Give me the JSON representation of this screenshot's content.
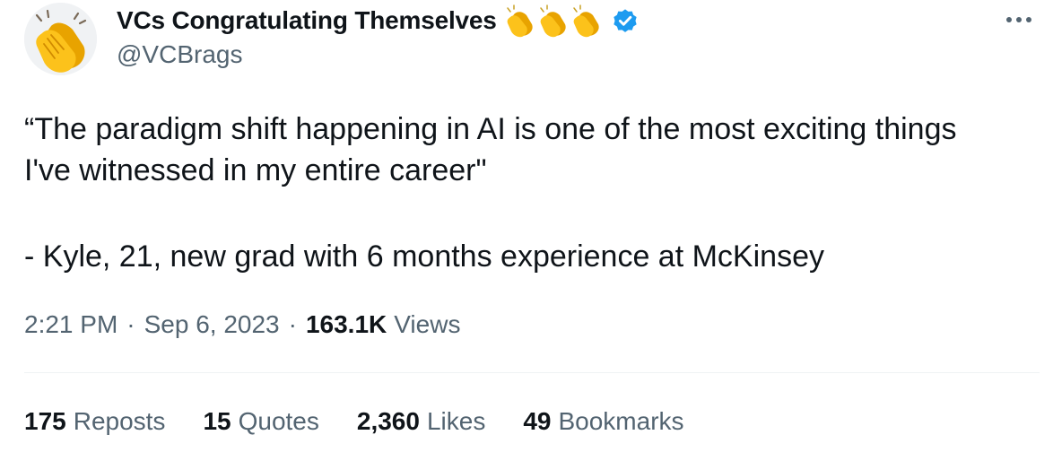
{
  "author": {
    "display_name": "VCs Congratulating Themselves",
    "handle": "@VCBrags",
    "avatar_icon": "clapping-hands-emoji",
    "name_emojis": [
      "clapping-hands-emoji",
      "clapping-hands-emoji",
      "clapping-hands-emoji"
    ],
    "verified": true,
    "verified_color": "#1d9bf0"
  },
  "tweet": {
    "lines": [
      "“The paradigm shift happening in AI is one of the most exciting things",
      "I've witnessed in my entire career\"",
      "- Kyle, 21, new grad with 6 months experience at McKinsey"
    ]
  },
  "meta": {
    "time": "2:21 PM",
    "separator": "·",
    "date": "Sep 6, 2023",
    "views_count": "163.1K",
    "views_label": "Views"
  },
  "stats": [
    {
      "count": "175",
      "label": "Reposts"
    },
    {
      "count": "15",
      "label": "Quotes"
    },
    {
      "count": "2,360",
      "label": "Likes"
    },
    {
      "count": "49",
      "label": "Bookmarks"
    }
  ],
  "more_icon": "more-horizontal-icon",
  "colors": {
    "primary_text": "#0f1419",
    "secondary_text": "#536471",
    "divider": "#eff3f4",
    "emoji_yellow": "#fcc21b"
  }
}
